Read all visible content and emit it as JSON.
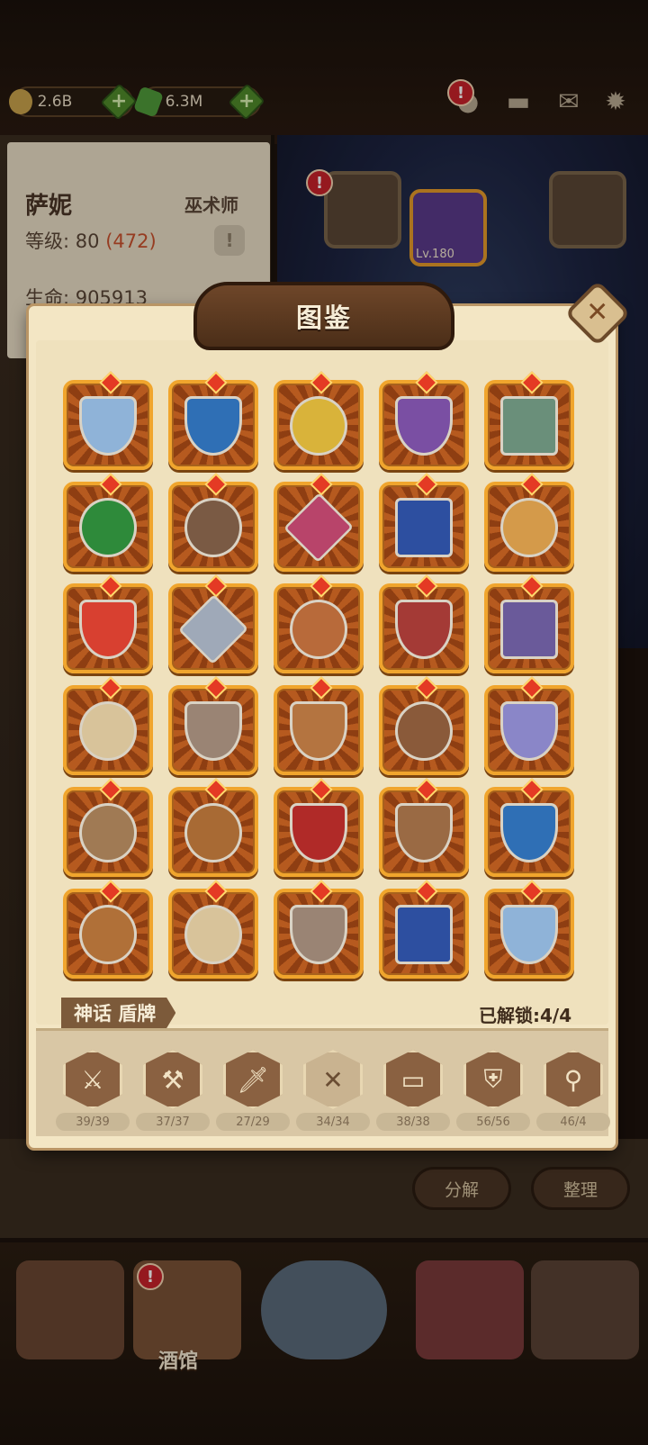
{
  "resources": [
    {
      "name": "gold",
      "value": "2.6B",
      "color": "#c9a24b"
    },
    {
      "name": "gem",
      "value": "6.3M",
      "color": "#4f9a3a"
    }
  ],
  "top_icons": [
    "alert-gift-icon",
    "chat-icon",
    "mail-icon",
    "settings-icon"
  ],
  "hero": {
    "name": "萨妮",
    "class": "巫术师",
    "level_label": "等级:",
    "level": "80",
    "level_rank": "(472)",
    "hp_label": "生命:",
    "hp": "905913"
  },
  "equip_slot_level": "Lv.180",
  "modal": {
    "title": "图鉴",
    "close_icon": "close-icon",
    "category_label": "神话 盾牌",
    "unlock_text": "已解锁:4/4"
  },
  "items": [
    {
      "icon": "antler-heater-shield",
      "color": "#8fb3d8"
    },
    {
      "icon": "axe-kite-shield",
      "color": "#2f6fb5"
    },
    {
      "icon": "yellow-blue-round-shield",
      "color": "#d9b33a"
    },
    {
      "icon": "hourglass-shield",
      "color": "#7a4fa3"
    },
    {
      "icon": "barrel-shield",
      "color": "#6a8f7a"
    },
    {
      "icon": "clover-oval-shield",
      "color": "#2e8a3a"
    },
    {
      "icon": "spiked-round-shield",
      "color": "#7a5a44"
    },
    {
      "icon": "rose-banner-shield",
      "color": "#b8446a"
    },
    {
      "icon": "seahorse-banner-shield",
      "color": "#2d4fa0"
    },
    {
      "icon": "axe-round-shield",
      "color": "#d49a4a"
    },
    {
      "icon": "wolf-heater-shield",
      "color": "#d84030"
    },
    {
      "icon": "diamond-wood-shield",
      "color": "#9fa9b8"
    },
    {
      "icon": "wood-round-shield",
      "color": "#b86a3a"
    },
    {
      "icon": "crimson-leaf-shield",
      "color": "#a43a36"
    },
    {
      "icon": "violet-tower-shield",
      "color": "#6a5a9a"
    },
    {
      "icon": "bronze-buckler",
      "color": "#d8c39a"
    },
    {
      "icon": "stone-heater-shield",
      "color": "#9a8474"
    },
    {
      "icon": "wood-kite-shield",
      "color": "#b47440"
    },
    {
      "icon": "iron-round-shield",
      "color": "#8a5a3a"
    },
    {
      "icon": "violet-heater-shield",
      "color": "#8a86c8"
    },
    {
      "icon": "plank-round-shield",
      "color": "#a07a54"
    },
    {
      "icon": "boss-round-shield",
      "color": "#a86a34"
    },
    {
      "icon": "red-black-heater-shield",
      "color": "#b02a28"
    },
    {
      "icon": "iron-kite-shield",
      "color": "#9a6a44"
    },
    {
      "icon": "axe-kite-shield-blue",
      "color": "#2f6fb5"
    },
    {
      "icon": "boss-round-shield-2",
      "color": "#b07038"
    },
    {
      "icon": "bronze-buckler-2",
      "color": "#d8c39a"
    },
    {
      "icon": "stone-heater-shield-2",
      "color": "#9a8474"
    },
    {
      "icon": "seahorse-banner-shield-2",
      "color": "#2d4fa0"
    },
    {
      "icon": "antler-heater-shield-2",
      "color": "#8fb3d8"
    }
  ],
  "tabs": [
    {
      "icon": "sword-icon",
      "count": "39/39"
    },
    {
      "icon": "club-icon",
      "count": "37/37"
    },
    {
      "icon": "dagger-icon",
      "count": "27/29"
    },
    {
      "icon": "shield-cross-icon",
      "count": "34/34"
    },
    {
      "icon": "book-icon",
      "count": "38/38"
    },
    {
      "icon": "armor-icon",
      "count": "56/56"
    },
    {
      "icon": "amulet-icon",
      "count": "46/4"
    }
  ],
  "side_buttons": {
    "decompose": "分解",
    "organize": "整理"
  },
  "nav": {
    "tavern": "酒馆"
  }
}
